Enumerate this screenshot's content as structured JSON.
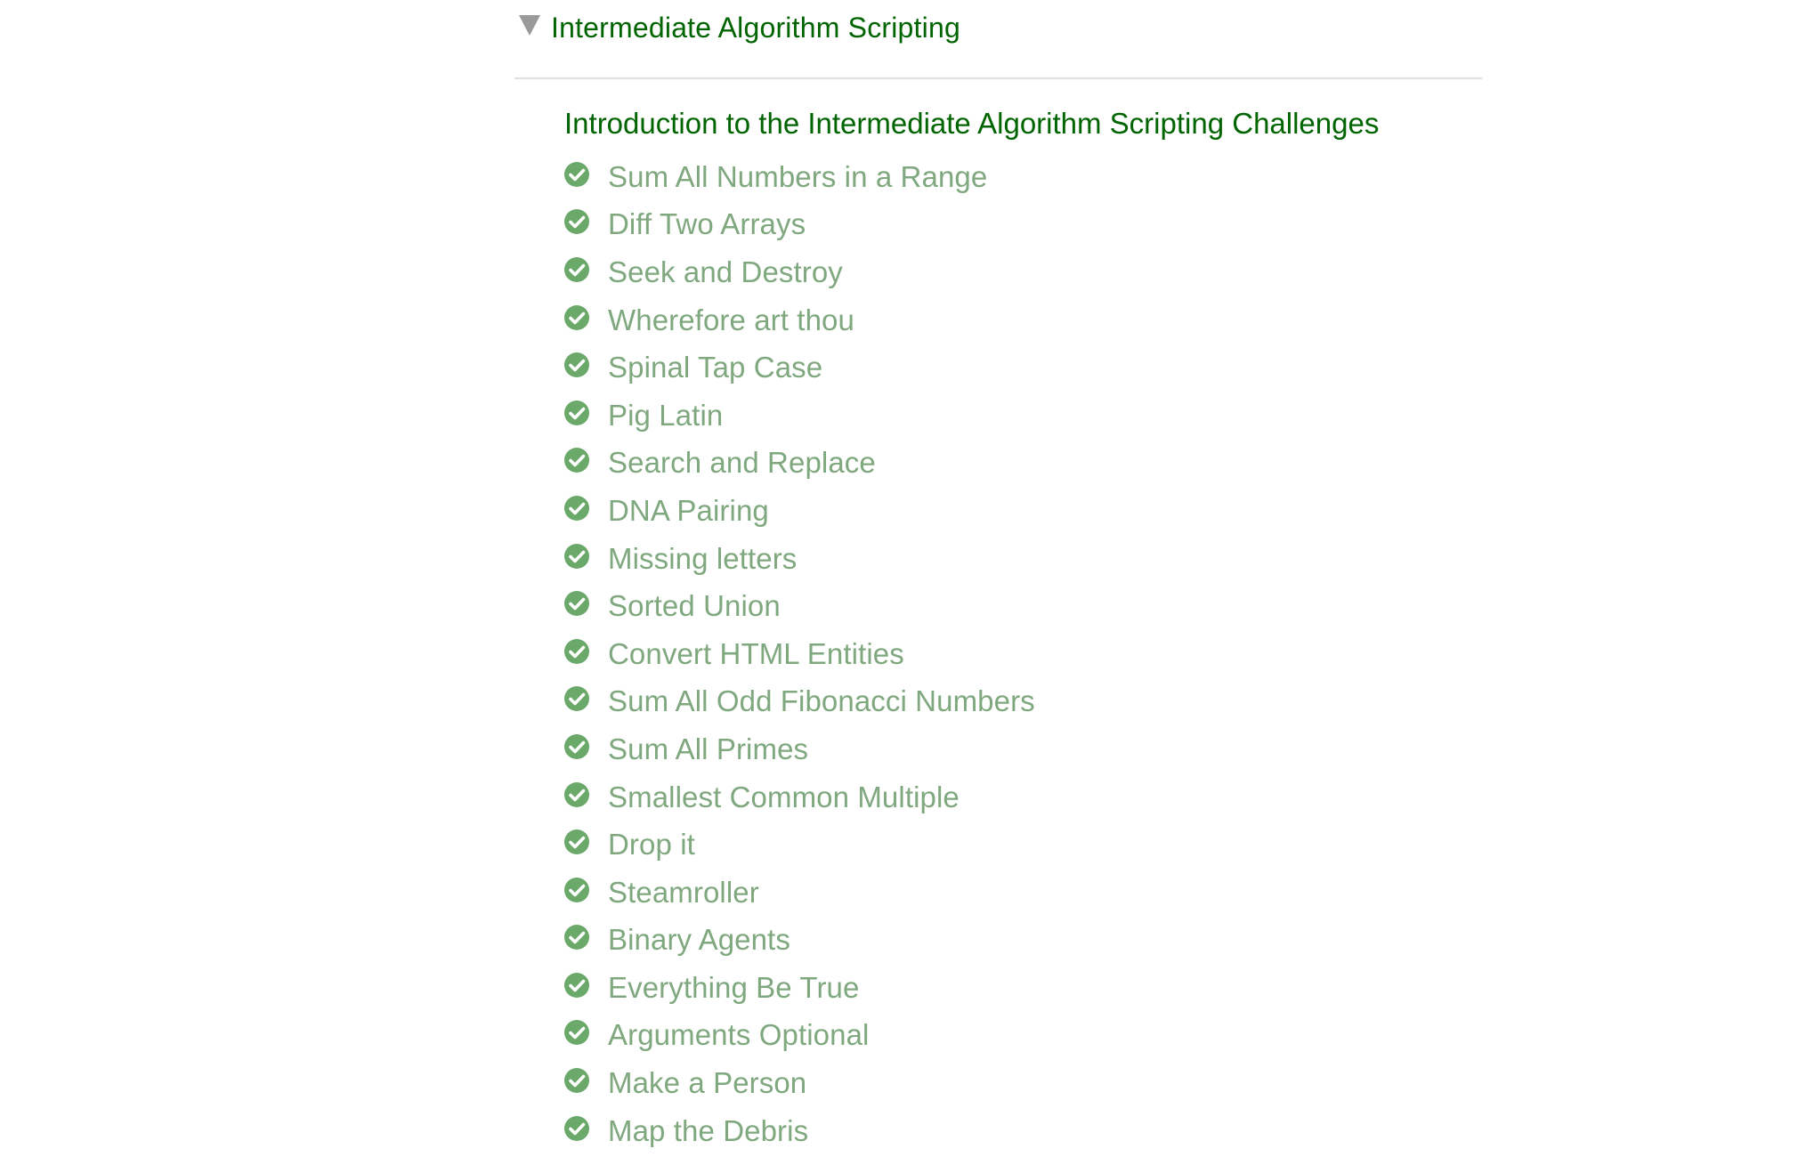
{
  "section": {
    "title": "Intermediate Algorithm Scripting",
    "expanded": true,
    "caret_icon": "caret-down-icon",
    "intro_link": "Introduction to the Intermediate Algorithm Scripting Challenges",
    "challenges": [
      {
        "label": "Sum All Numbers in a Range",
        "completed": true
      },
      {
        "label": "Diff Two Arrays",
        "completed": true
      },
      {
        "label": "Seek and Destroy",
        "completed": true
      },
      {
        "label": "Wherefore art thou",
        "completed": true
      },
      {
        "label": "Spinal Tap Case",
        "completed": true
      },
      {
        "label": "Pig Latin",
        "completed": true
      },
      {
        "label": "Search and Replace",
        "completed": true
      },
      {
        "label": "DNA Pairing",
        "completed": true
      },
      {
        "label": "Missing letters",
        "completed": true
      },
      {
        "label": "Sorted Union",
        "completed": true
      },
      {
        "label": "Convert HTML Entities",
        "completed": true
      },
      {
        "label": "Sum All Odd Fibonacci Numbers",
        "completed": true
      },
      {
        "label": "Sum All Primes",
        "completed": true
      },
      {
        "label": "Smallest Common Multiple",
        "completed": true
      },
      {
        "label": "Drop it",
        "completed": true
      },
      {
        "label": "Steamroller",
        "completed": true
      },
      {
        "label": "Binary Agents",
        "completed": true
      },
      {
        "label": "Everything Be True",
        "completed": true
      },
      {
        "label": "Arguments Optional",
        "completed": true
      },
      {
        "label": "Make a Person",
        "completed": true
      },
      {
        "label": "Map the Debris",
        "completed": true
      }
    ]
  },
  "colors": {
    "title_green": "#006400",
    "completed_green": "#7fa87f",
    "check_green": "#6aa96a",
    "caret_gray": "#9a9a9a",
    "divider": "#e0e0e0"
  }
}
